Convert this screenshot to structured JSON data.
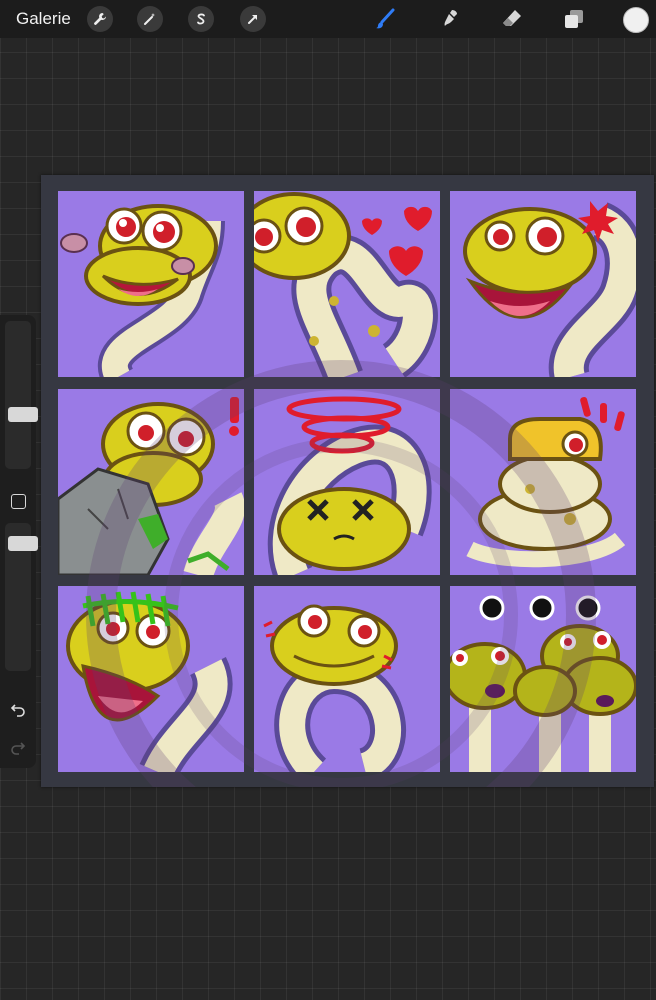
{
  "toolbar": {
    "gallery_label": "Galerie",
    "left_tools": [
      {
        "icon": "wrench-icon",
        "name": "actions"
      },
      {
        "icon": "magic-wand-icon",
        "name": "adjustments"
      },
      {
        "icon": "selection-s-icon",
        "name": "selection"
      },
      {
        "icon": "arrow-cursor-icon",
        "name": "transform"
      }
    ],
    "right_tools": [
      {
        "icon": "brush-icon",
        "name": "paint",
        "active": true
      },
      {
        "icon": "smudge-icon",
        "name": "smudge"
      },
      {
        "icon": "eraser-icon",
        "name": "erase"
      },
      {
        "icon": "layers-icon",
        "name": "layers"
      }
    ],
    "active_color": "#f0f0f0",
    "accent": "#2f7cf6"
  },
  "sidebar": {
    "size_level": 0.35,
    "opacity_level": 0.9
  },
  "canvas": {
    "tile_background": "#9a7ae6",
    "snake_color": "#d9cf1d",
    "emotes": [
      {
        "name": "emote-blush"
      },
      {
        "name": "emote-hearts"
      },
      {
        "name": "emote-angry"
      },
      {
        "name": "emote-surprised"
      },
      {
        "name": "emote-dizzy"
      },
      {
        "name": "emote-alert"
      },
      {
        "name": "emote-shocked"
      },
      {
        "name": "emote-shy"
      },
      {
        "name": "emote-ellipsis"
      }
    ]
  }
}
